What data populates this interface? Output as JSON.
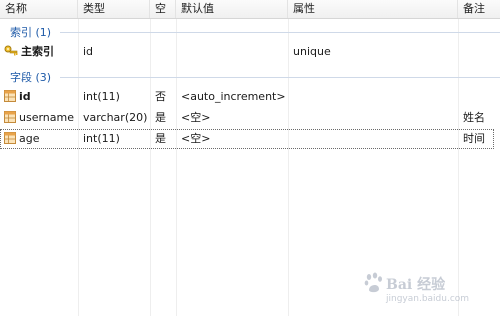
{
  "header": {
    "columns": [
      "名称",
      "类型",
      "空",
      "默认值",
      "属性",
      "备注"
    ]
  },
  "groups": {
    "index": {
      "label": "索引 (1)",
      "rows": [
        {
          "name": "主索引",
          "type": "id",
          "null": "",
          "default": "",
          "attr": "unique",
          "comment": "",
          "icon": "key-icon"
        }
      ]
    },
    "fields": {
      "label": "字段 (3)",
      "rows": [
        {
          "name": "id",
          "type": "int(11)",
          "null": "否",
          "default": "<auto_increment>",
          "attr": "",
          "comment": "",
          "icon": "table-field-icon"
        },
        {
          "name": "username",
          "type": "varchar(20)",
          "null": "是",
          "default": "<空>",
          "attr": "",
          "comment": "姓名",
          "icon": "table-field-icon"
        },
        {
          "name": "age",
          "type": "int(11)",
          "null": "是",
          "default": "<空>",
          "attr": "",
          "comment": "时间",
          "icon": "table-field-icon"
        }
      ]
    }
  },
  "watermark": {
    "brand": "Bai 经验",
    "url": "jingyan.baidu.com"
  },
  "colors": {
    "group_text": "#1e5aa8",
    "header_bg": "#f0f0f0"
  }
}
